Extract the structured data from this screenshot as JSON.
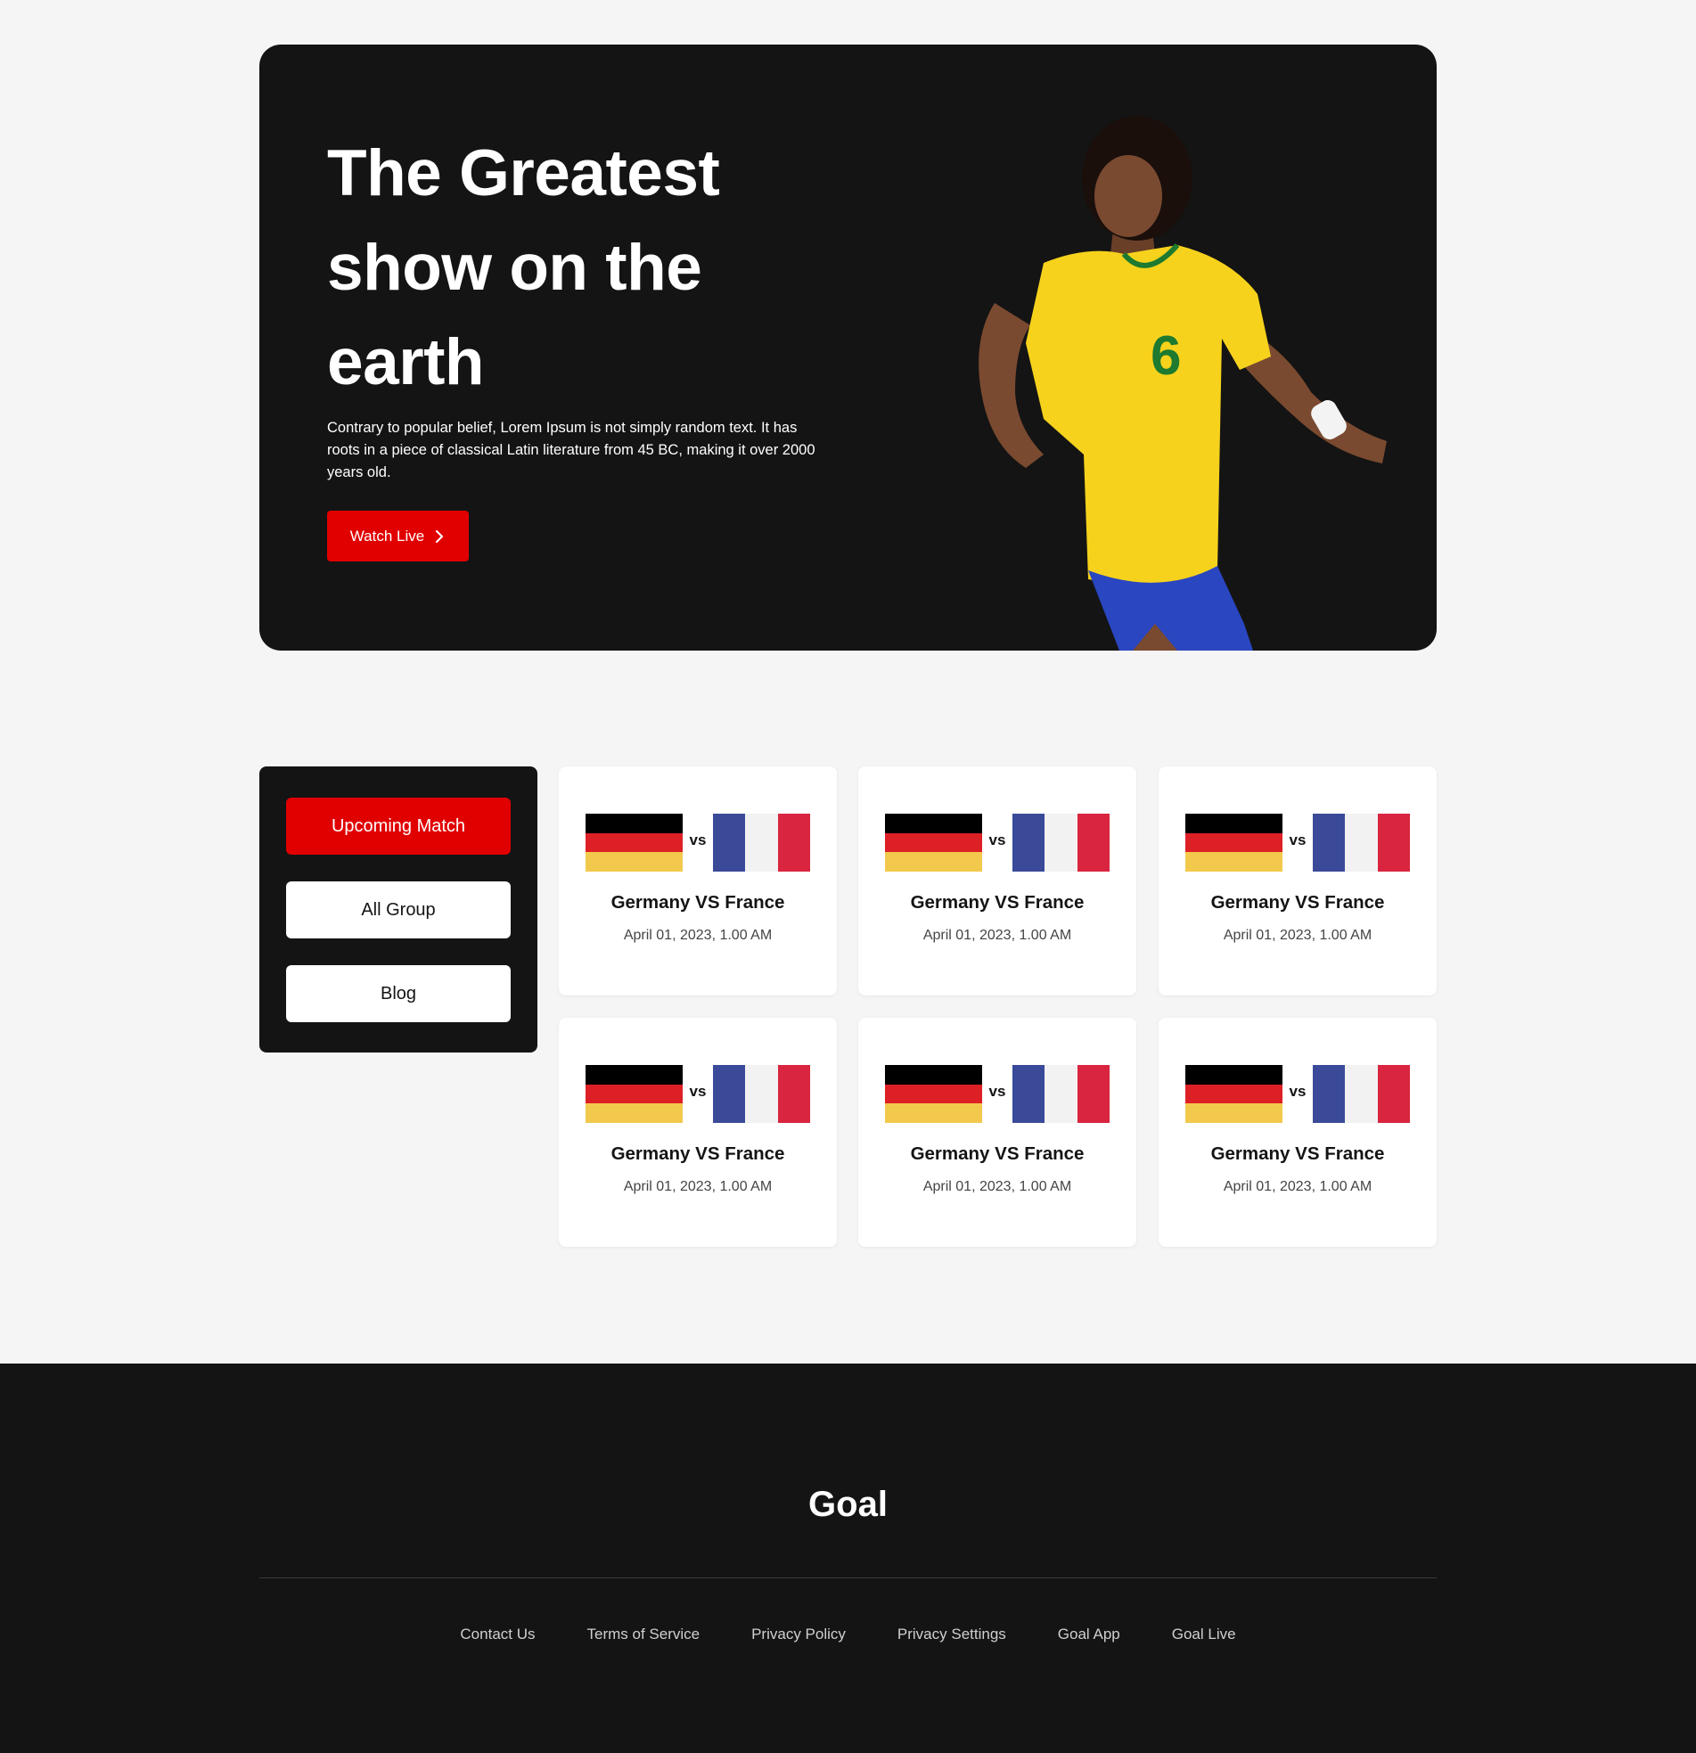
{
  "hero": {
    "title_lines": [
      "The Greatest",
      "show on the",
      "earth"
    ],
    "description": "Contrary to popular belief, Lorem Ipsum is not simply random text. It has roots in a piece of classical Latin literature from 45 BC, making it over 2000 years old.",
    "cta_label": "Watch Live",
    "cta_icon": "chevron-right-icon"
  },
  "sidebar": {
    "items": [
      {
        "label": "Upcoming Match",
        "active": true
      },
      {
        "label": "All Group",
        "active": false
      },
      {
        "label": "Blog",
        "active": false
      }
    ]
  },
  "matches": [
    {
      "title": "Germany VS France",
      "date": "April 01, 2023, 1.00 AM",
      "vs": "vs"
    },
    {
      "title": "Germany VS France",
      "date": "April 01, 2023, 1.00 AM",
      "vs": "vs"
    },
    {
      "title": "Germany VS France",
      "date": "April 01, 2023, 1.00 AM",
      "vs": "vs"
    },
    {
      "title": "Germany VS France",
      "date": "April 01, 2023, 1.00 AM",
      "vs": "vs"
    },
    {
      "title": "Germany VS France",
      "date": "April 01, 2023, 1.00 AM",
      "vs": "vs"
    },
    {
      "title": "Germany VS France",
      "date": "April 01, 2023, 1.00 AM",
      "vs": "vs"
    }
  ],
  "footer": {
    "brand": "Goal",
    "links": [
      "Contact Us",
      "Terms of Service",
      "Privacy Policy",
      "Privacy Settings",
      "Goal App",
      "Goal Live"
    ]
  },
  "colors": {
    "accent": "#e10000",
    "dark": "#141414",
    "background": "#f5f5f5",
    "germany": [
      "#000000",
      "#dd2026",
      "#f2c94c"
    ],
    "france": [
      "#3a4a99",
      "#f2f2f2",
      "#d9253f"
    ]
  }
}
